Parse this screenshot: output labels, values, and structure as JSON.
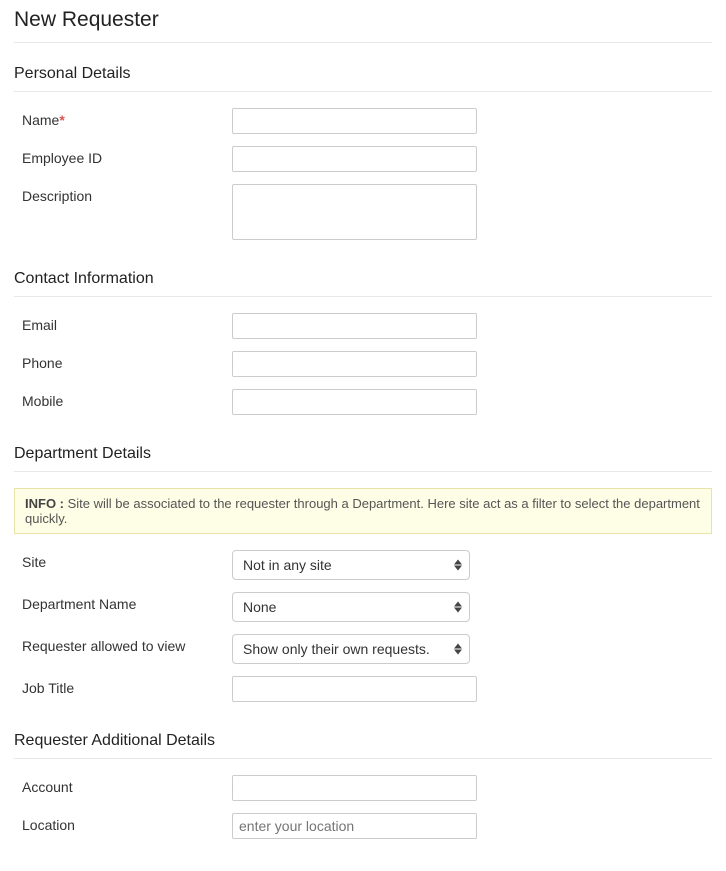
{
  "page_title": "New Requester",
  "sections": {
    "personal": {
      "title": "Personal Details",
      "fields": {
        "name_label": "Name",
        "employee_id_label": "Employee ID",
        "description_label": "Description"
      }
    },
    "contact": {
      "title": "Contact Information",
      "fields": {
        "email_label": "Email",
        "phone_label": "Phone",
        "mobile_label": "Mobile"
      }
    },
    "department": {
      "title": "Department Details",
      "info_prefix": "INFO :",
      "info_text": " Site will be associated to the requester through a Department. Here site act as a filter to select the department quickly.",
      "fields": {
        "site_label": "Site",
        "site_value": "Not in any site",
        "department_name_label": "Department Name",
        "department_name_value": "None",
        "view_label": "Requester allowed to view",
        "view_value": "Show only their own requests.",
        "job_title_label": "Job Title"
      }
    },
    "additional": {
      "title": "Requester Additional Details",
      "fields": {
        "account_label": "Account",
        "location_label": "Location",
        "location_placeholder": "enter your location"
      }
    }
  }
}
